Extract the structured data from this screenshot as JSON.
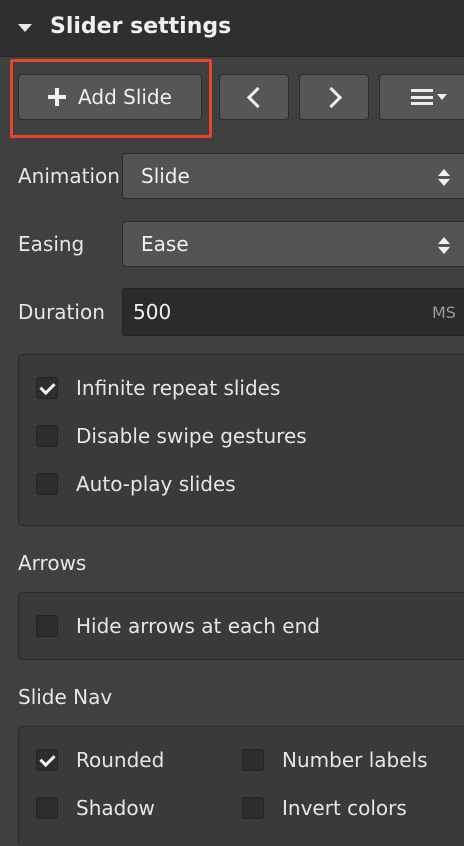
{
  "header": {
    "title": "Slider settings"
  },
  "toolbar": {
    "add_slide_label": "Add Slide",
    "prev_icon": "chevron-left-icon",
    "next_icon": "chevron-right-icon",
    "menu_icon": "menu-dropdown-icon"
  },
  "fields": {
    "animation": {
      "label": "Animation",
      "value": "Slide"
    },
    "easing": {
      "label": "Easing",
      "value": "Ease"
    },
    "duration": {
      "label": "Duration",
      "value": "500",
      "unit": "MS"
    }
  },
  "options": [
    {
      "label": "Infinite repeat slides",
      "checked": true
    },
    {
      "label": "Disable swipe gestures",
      "checked": false
    },
    {
      "label": "Auto-play slides",
      "checked": false
    }
  ],
  "arrows": {
    "heading": "Arrows",
    "options": [
      {
        "label": "Hide arrows at each end",
        "checked": false
      }
    ]
  },
  "slide_nav": {
    "heading": "Slide Nav",
    "options": [
      {
        "label": "Rounded",
        "checked": true
      },
      {
        "label": "Number labels",
        "checked": false
      },
      {
        "label": "Shadow",
        "checked": false
      },
      {
        "label": "Invert colors",
        "checked": false
      }
    ]
  },
  "colors": {
    "highlight": "#e8442e",
    "panel_bg": "#404040",
    "header_bg": "#2f2f2f"
  }
}
